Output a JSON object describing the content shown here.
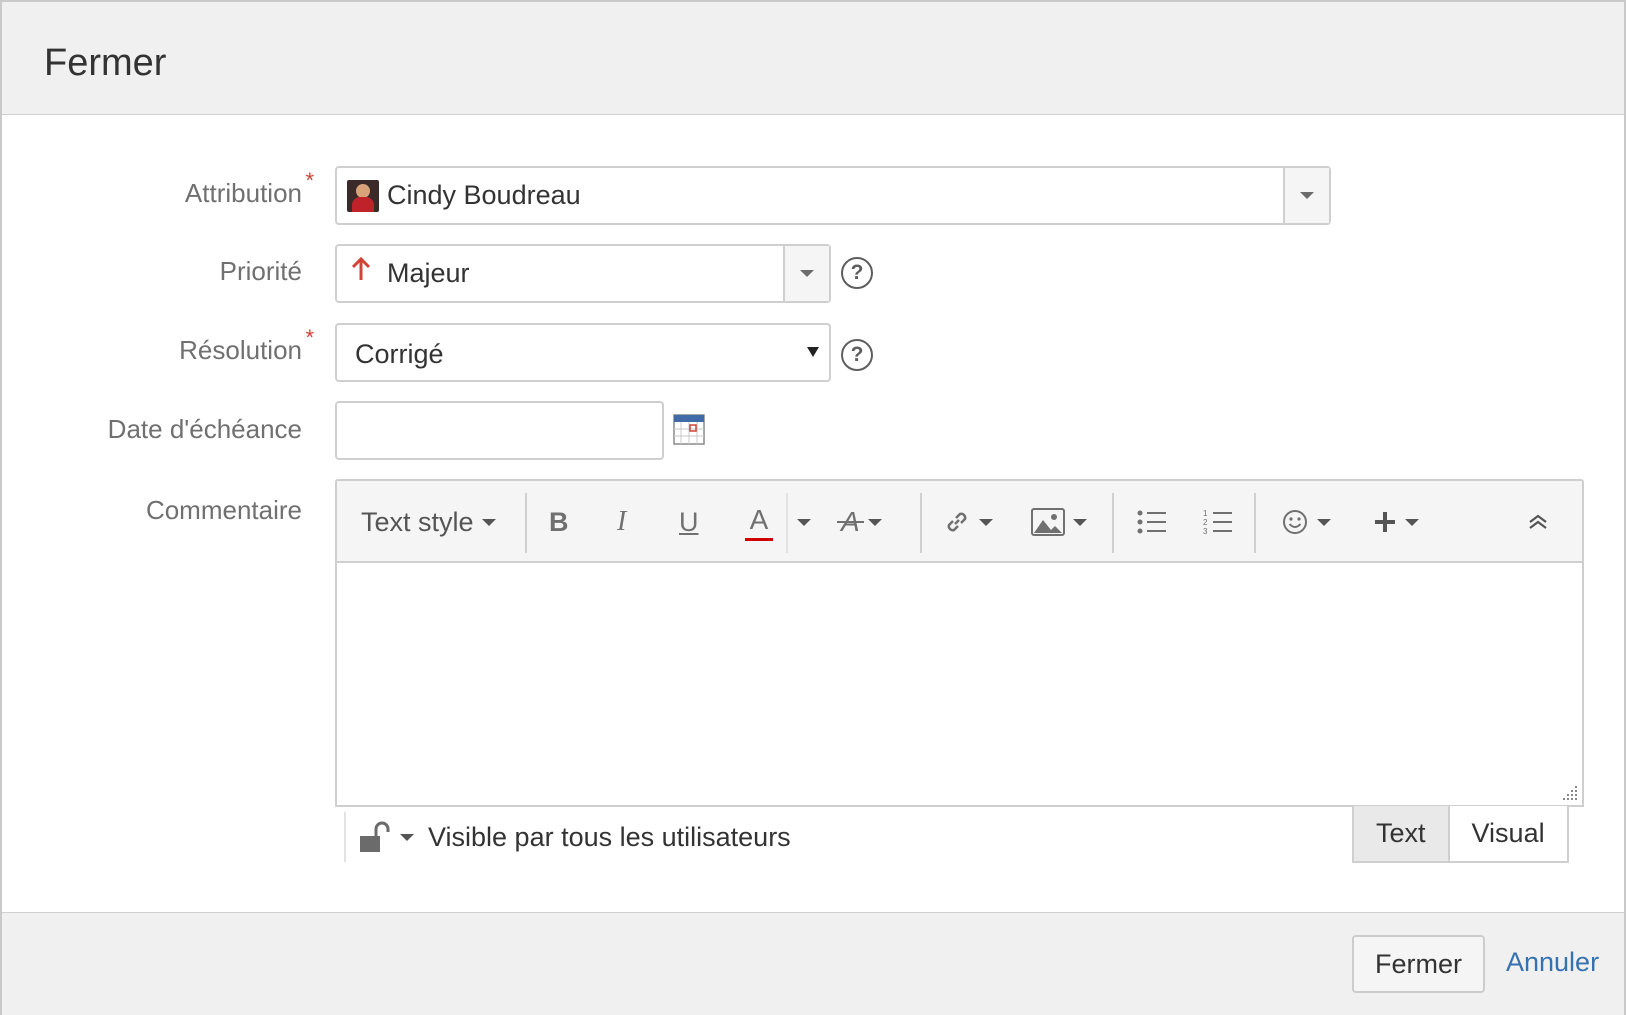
{
  "dialog": {
    "title": "Fermer"
  },
  "form": {
    "assignee": {
      "label": "Attribution",
      "required_mark": "*",
      "value": "Cindy Boudreau"
    },
    "priority": {
      "label": "Priorité",
      "value": "Majeur",
      "help": "?"
    },
    "resolution": {
      "label": "Résolution",
      "required_mark": "*",
      "value": "Corrigé",
      "help": "?"
    },
    "due_date": {
      "label": "Date d'échéance",
      "value": "",
      "placeholder": ""
    },
    "comment": {
      "label": "Commentaire",
      "toolbar": {
        "text_style": "Text style",
        "bold": "B",
        "italic": "I",
        "underline": "U",
        "text_color": "A",
        "more_formatting": "A"
      },
      "visibility": "Visible par tous les utilisateurs",
      "tabs": [
        "Text",
        "Visual"
      ],
      "active_tab": "Text"
    }
  },
  "footer": {
    "submit_label": "Fermer",
    "cancel_label": "Annuler"
  },
  "colors": {
    "required": "#d04437",
    "link": "#3572b0",
    "priority_arrow": "#d04437"
  }
}
